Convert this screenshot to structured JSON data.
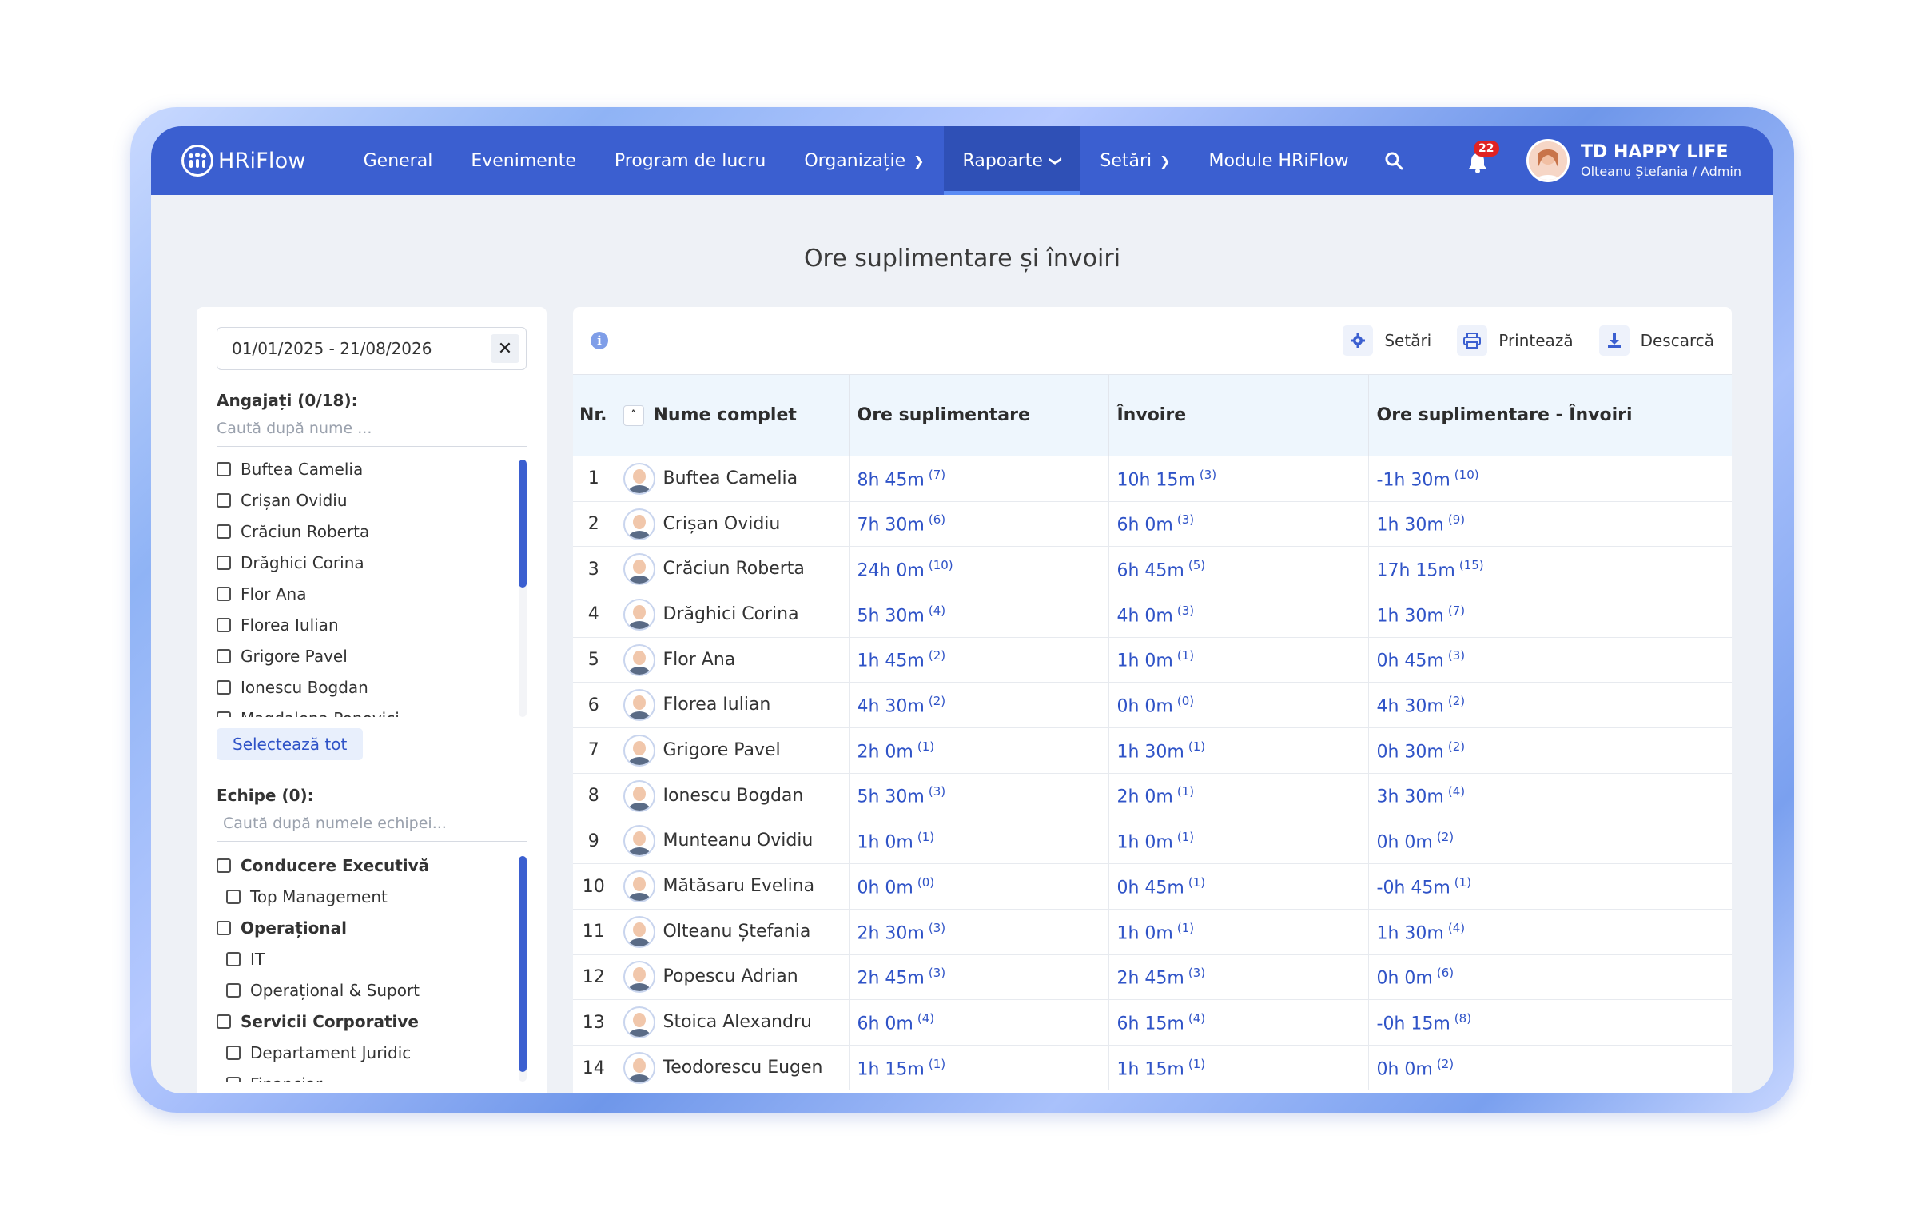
{
  "brand": {
    "name": "HRiFlow"
  },
  "nav": {
    "items": [
      {
        "label": "General",
        "has_chevron": false
      },
      {
        "label": "Evenimente",
        "has_chevron": false
      },
      {
        "label": "Program de lucru",
        "has_chevron": false
      },
      {
        "label": "Organizație",
        "has_chevron": true
      },
      {
        "label": "Rapoarte",
        "has_chevron": true,
        "active": true
      },
      {
        "label": "Setări",
        "has_chevron": true
      },
      {
        "label": "Module HRiFlow",
        "has_chevron": false
      }
    ],
    "notification_count": "22",
    "company": "TD HAPPY LIFE",
    "user_role": "Olteanu Ștefania / Admin"
  },
  "page_title": "Ore suplimentare și învoiri",
  "filters": {
    "date_range": "01/01/2025 - 21/08/2026",
    "employees_label": "Angajați (0/18):",
    "employees_search_placeholder": "Caută după nume ...",
    "employees": [
      "Buftea Camelia",
      "Crișan Ovidiu",
      "Crăciun Roberta",
      "Drăghici Corina",
      "Flor Ana",
      "Florea Iulian",
      "Grigore Pavel",
      "Ionescu Bogdan",
      "Magdalena Popovici"
    ],
    "select_all_label": "Selectează tot",
    "teams_label": "Echipe (0):",
    "teams_search_placeholder": "Caută după numele echipei...",
    "teams": [
      {
        "name": "Conducere Executivă",
        "level": 0
      },
      {
        "name": "Top Management",
        "level": 1
      },
      {
        "name": "Operațional",
        "level": 0
      },
      {
        "name": "IT",
        "level": 1
      },
      {
        "name": "Operațional & Suport",
        "level": 1
      },
      {
        "name": "Servicii Corporative",
        "level": 0
      },
      {
        "name": "Departament Juridic",
        "level": 1
      },
      {
        "name": "Financiar",
        "level": 1
      }
    ]
  },
  "toolbar": {
    "settings": "Setări",
    "print": "Printează",
    "download": "Descarcă"
  },
  "table": {
    "columns": [
      "Nr.",
      "Nume complet",
      "Ore suplimentare",
      "Învoire",
      "Ore suplimentare - Învoiri"
    ],
    "rows": [
      {
        "nr": "1",
        "name": "Buftea Camelia",
        "overtime": "8h 45m",
        "overtime_count": "(7)",
        "leave": "10h 15m",
        "leave_count": "(3)",
        "diff": "-1h 30m",
        "diff_count": "(10)"
      },
      {
        "nr": "2",
        "name": "Crișan Ovidiu",
        "overtime": "7h 30m",
        "overtime_count": "(6)",
        "leave": "6h 0m",
        "leave_count": "(3)",
        "diff": "1h 30m",
        "diff_count": "(9)"
      },
      {
        "nr": "3",
        "name": "Crăciun Roberta",
        "overtime": "24h 0m",
        "overtime_count": "(10)",
        "leave": "6h 45m",
        "leave_count": "(5)",
        "diff": "17h 15m",
        "diff_count": "(15)"
      },
      {
        "nr": "4",
        "name": "Drăghici Corina",
        "overtime": "5h 30m",
        "overtime_count": "(4)",
        "leave": "4h 0m",
        "leave_count": "(3)",
        "diff": "1h 30m",
        "diff_count": "(7)"
      },
      {
        "nr": "5",
        "name": "Flor Ana",
        "overtime": "1h 45m",
        "overtime_count": "(2)",
        "leave": "1h 0m",
        "leave_count": "(1)",
        "diff": "0h 45m",
        "diff_count": "(3)"
      },
      {
        "nr": "6",
        "name": "Florea Iulian",
        "overtime": "4h 30m",
        "overtime_count": "(2)",
        "leave": "0h 0m",
        "leave_count": "(0)",
        "diff": "4h 30m",
        "diff_count": "(2)"
      },
      {
        "nr": "7",
        "name": "Grigore Pavel",
        "overtime": "2h 0m",
        "overtime_count": "(1)",
        "leave": "1h 30m",
        "leave_count": "(1)",
        "diff": "0h 30m",
        "diff_count": "(2)"
      },
      {
        "nr": "8",
        "name": "Ionescu Bogdan",
        "overtime": "5h 30m",
        "overtime_count": "(3)",
        "leave": "2h 0m",
        "leave_count": "(1)",
        "diff": "3h 30m",
        "diff_count": "(4)"
      },
      {
        "nr": "9",
        "name": "Munteanu Ovidiu",
        "overtime": "1h 0m",
        "overtime_count": "(1)",
        "leave": "1h 0m",
        "leave_count": "(1)",
        "diff": "0h 0m",
        "diff_count": "(2)"
      },
      {
        "nr": "10",
        "name": "Mătăsaru Evelina",
        "overtime": "0h 0m",
        "overtime_count": "(0)",
        "leave": "0h 45m",
        "leave_count": "(1)",
        "diff": "-0h 45m",
        "diff_count": "(1)"
      },
      {
        "nr": "11",
        "name": "Olteanu Ștefania",
        "overtime": "2h 30m",
        "overtime_count": "(3)",
        "leave": "1h 0m",
        "leave_count": "(1)",
        "diff": "1h 30m",
        "diff_count": "(4)"
      },
      {
        "nr": "12",
        "name": "Popescu Adrian",
        "overtime": "2h 45m",
        "overtime_count": "(3)",
        "leave": "2h 45m",
        "leave_count": "(3)",
        "diff": "0h 0m",
        "diff_count": "(6)"
      },
      {
        "nr": "13",
        "name": "Stoica Alexandru",
        "overtime": "6h 0m",
        "overtime_count": "(4)",
        "leave": "6h 15m",
        "leave_count": "(4)",
        "diff": "-0h 15m",
        "diff_count": "(8)"
      },
      {
        "nr": "14",
        "name": "Teodorescu Eugen",
        "overtime": "1h 15m",
        "overtime_count": "(1)",
        "leave": "1h 15m",
        "leave_count": "(1)",
        "diff": "0h 0m",
        "diff_count": "(2)"
      }
    ]
  },
  "colors": {
    "primary": "#3b5fd0",
    "link": "#2f53c7",
    "badge": "#e02323"
  }
}
